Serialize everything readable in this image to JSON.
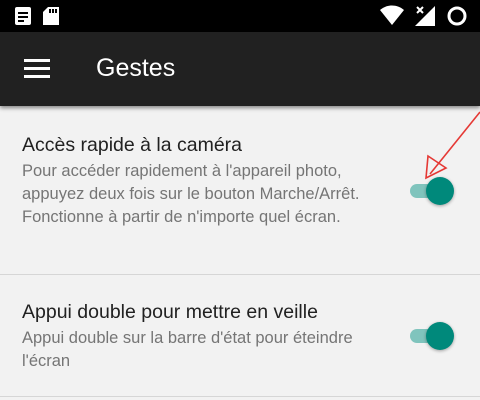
{
  "status_bar": {
    "icons_left": [
      "notes-icon",
      "sd-card-icon"
    ],
    "icons_right": [
      "wifi-icon",
      "signal-no-data-icon",
      "battery-ring-icon"
    ]
  },
  "app_bar": {
    "title": "Gestes",
    "menu_icon": "hamburger-menu-icon"
  },
  "settings": [
    {
      "title": "Accès rapide à la caméra",
      "description": "Pour accéder rapidement à l'appareil photo, appuyez deux fois sur le bouton Marche/Arrêt. Fonctionne à partir de n'importe quel écran.",
      "enabled": true
    },
    {
      "title": "Appui double pour mettre en veille",
      "description": "Appui double sur la barre d'état pour éteindre l'écran",
      "enabled": true
    }
  ],
  "colors": {
    "accent": "#00897b",
    "accent_track": "#80c4bd",
    "annotation": "#e53935",
    "app_bar": "#212121",
    "background": "#f2f2f2"
  }
}
